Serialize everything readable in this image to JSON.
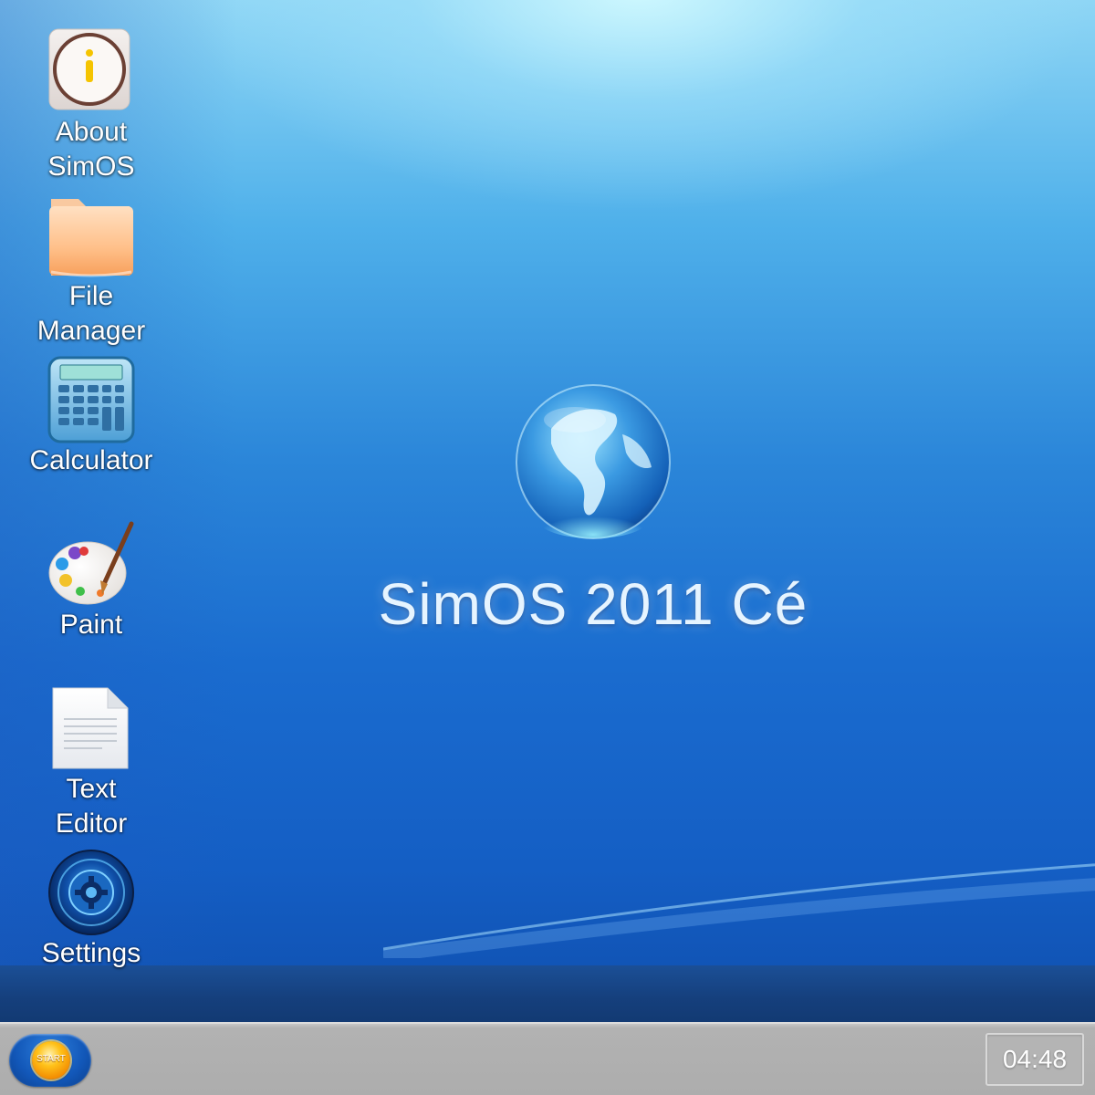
{
  "desktop": {
    "icons": [
      {
        "label": "About\nSimOS",
        "icon": "info-icon"
      },
      {
        "label": "File\nManager",
        "icon": "folder-icon"
      },
      {
        "label": "Calculator",
        "icon": "calculator-icon"
      },
      {
        "label": "Paint",
        "icon": "paint-palette-icon"
      },
      {
        "label": "Text\nEditor",
        "icon": "document-icon"
      },
      {
        "label": "Settings",
        "icon": "gear-icon"
      }
    ],
    "logo": {
      "title": "SimOS 2011 Cé",
      "icon": "globe-icon"
    }
  },
  "taskbar": {
    "start_label": "START",
    "clock": "04:48"
  },
  "colors": {
    "wallpaper_top": "#8fd6f5",
    "wallpaper_bottom": "#0f4fae",
    "taskbar": "#adadad",
    "start_orb": "#f28a00"
  }
}
